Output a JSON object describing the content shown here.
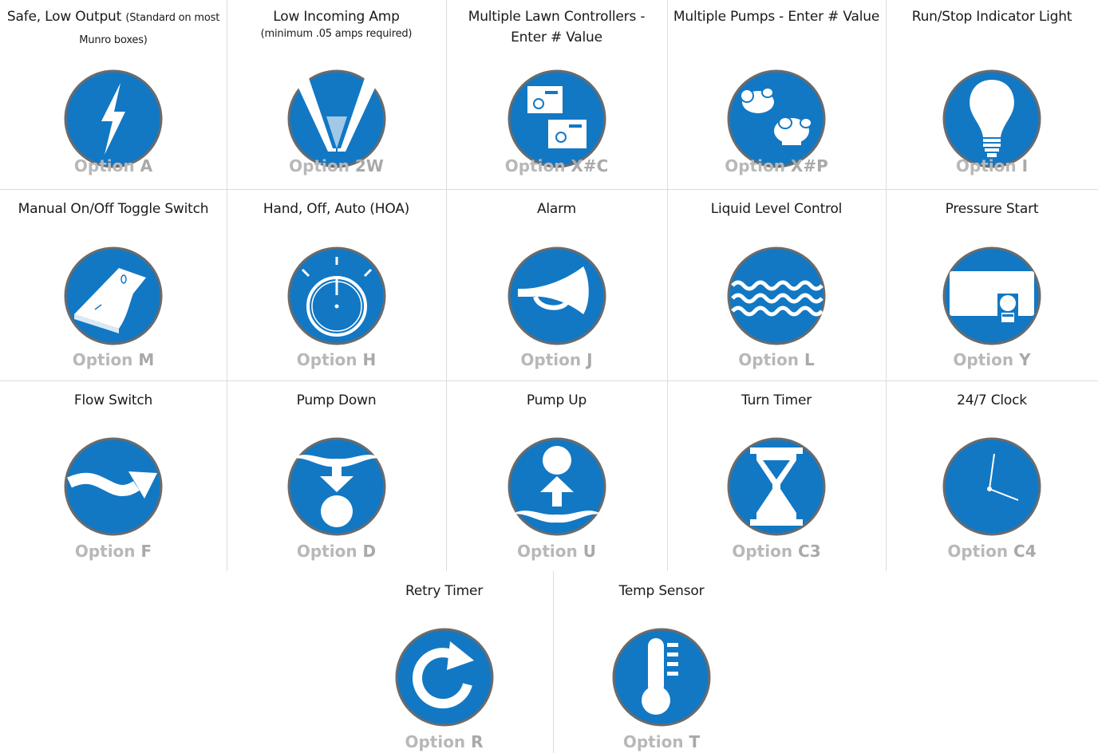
{
  "colors": {
    "icon_blue": "#1278c4",
    "ring": "#6b6b6b",
    "option_gray": "#b8b8b8"
  },
  "option_prefix": "Option",
  "rows": [
    {
      "cells": [
        {
          "title": "Safe, Low Output",
          "title_small": "(Standard on most Munro boxes)",
          "code": "A",
          "icon": "lightning-bolt-icon"
        },
        {
          "title": "Low Incoming Amp",
          "subtitle": "(minimum .05 amps required)",
          "code": "2W",
          "icon": "wires-icon"
        },
        {
          "title": "Multiple Lawn Controllers - Enter # Value",
          "code": "X#C",
          "icon": "lawn-controllers-icon"
        },
        {
          "title": "Multiple Pumps - Enter # Value",
          "code": "X#P",
          "icon": "pumps-icon"
        },
        {
          "title": "Run/Stop Indicator Light",
          "code": "I",
          "icon": "light-bulb-icon"
        }
      ]
    },
    {
      "cells": [
        {
          "title": "Manual On/Off Toggle Switch",
          "code": "M",
          "icon": "toggle-switch-icon"
        },
        {
          "title": "Hand, Off, Auto (HOA)",
          "code": "H",
          "icon": "selector-dial-icon"
        },
        {
          "title": "Alarm",
          "code": "J",
          "icon": "horn-icon"
        },
        {
          "title": "Liquid Level Control",
          "code": "L",
          "icon": "waves-icon"
        },
        {
          "title": "Pressure Start",
          "code": "Y",
          "icon": "pressure-switch-icon"
        }
      ]
    },
    {
      "cells": [
        {
          "title": "Flow Switch",
          "code": "F",
          "icon": "flow-arrow-icon"
        },
        {
          "title": "Pump Down",
          "code": "D",
          "icon": "pump-down-icon"
        },
        {
          "title": "Pump Up",
          "code": "U",
          "icon": "pump-up-icon"
        },
        {
          "title": "Turn Timer",
          "code": "C3",
          "icon": "hourglass-icon"
        },
        {
          "title": "24/7 Clock",
          "code": "C4",
          "icon": "clock-icon"
        }
      ]
    },
    {
      "cells": [
        {
          "title": "Retry Timer",
          "code": "R",
          "icon": "retry-arrow-icon"
        },
        {
          "title": "Temp Sensor",
          "code": "T",
          "icon": "thermometer-icon"
        }
      ]
    }
  ]
}
